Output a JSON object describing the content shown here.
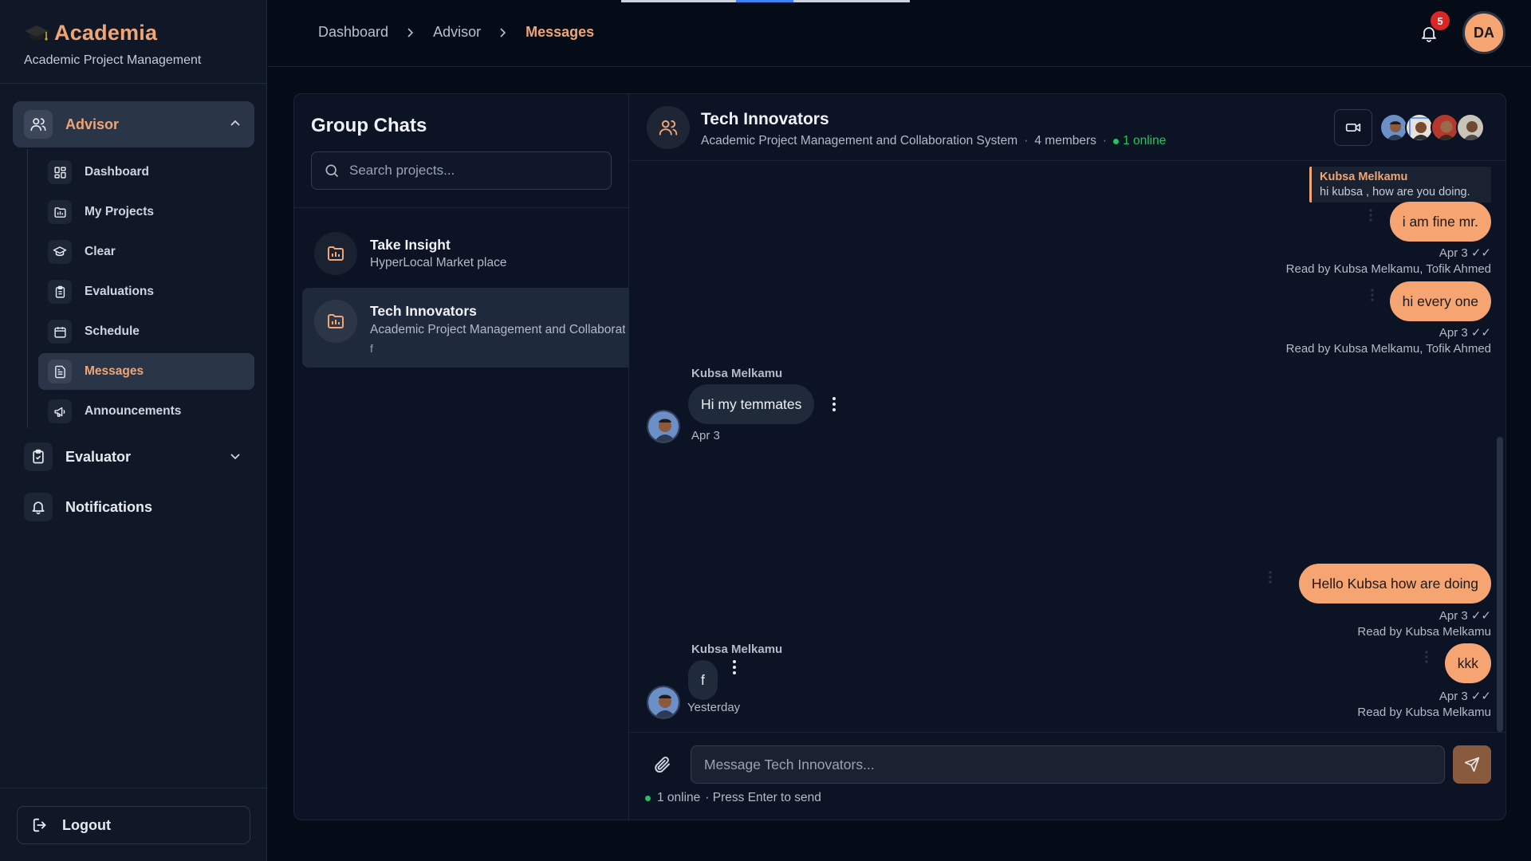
{
  "brand": {
    "title": "Academia",
    "subtitle": "Academic Project Management"
  },
  "sidebar": {
    "groups": [
      {
        "label": "Advisor",
        "icon": "users-icon",
        "expanded": true,
        "active": true
      },
      {
        "label": "Evaluator",
        "icon": "clipboard-check-icon",
        "expanded": false
      },
      {
        "label": "Notifications",
        "icon": "bell-icon"
      }
    ],
    "advisor_items": [
      {
        "label": "Dashboard",
        "icon": "grid-icon"
      },
      {
        "label": "My Projects",
        "icon": "folder-chart-icon"
      },
      {
        "label": "Clear",
        "icon": "graduation-cap-icon"
      },
      {
        "label": "Evaluations",
        "icon": "clipboard-list-icon"
      },
      {
        "label": "Schedule",
        "icon": "calendar-icon"
      },
      {
        "label": "Messages",
        "icon": "file-text-icon",
        "active": true
      },
      {
        "label": "Announcements",
        "icon": "megaphone-icon"
      }
    ],
    "logout_label": "Logout"
  },
  "header": {
    "breadcrumbs": [
      "Dashboard",
      "Advisor",
      "Messages"
    ],
    "notification_count": "5",
    "user_initials": "DA"
  },
  "chats": {
    "title": "Group Chats",
    "search_placeholder": "Search projects...",
    "items": [
      {
        "name": "Take Insight",
        "subtitle": "HyperLocal Market place",
        "last": ""
      },
      {
        "name": "Tech Innovators",
        "subtitle": "Academic Project Management and Collaboration System",
        "last": "f",
        "active": true
      }
    ]
  },
  "conversation": {
    "title": "Tech Innovators",
    "subtitle": "Academic Project Management and Collaboration System",
    "members": "4 members",
    "online": "1 online",
    "reply_quote": {
      "name": "Kubsa Melkamu",
      "text": "hi kubsa , how are you doing."
    },
    "messages": [
      {
        "dir": "out",
        "text": "i am fine mr.",
        "time": "Apr 3 ✓✓",
        "read": "Read by Kubsa Melkamu, Tofik Ahmed"
      },
      {
        "dir": "out",
        "text": "hi every one",
        "time": "Apr 3 ✓✓",
        "read": "Read by Kubsa Melkamu, Tofik Ahmed"
      },
      {
        "dir": "in",
        "sender": "Kubsa Melkamu",
        "text": "Hi my temmates",
        "time": "Apr 3"
      },
      {
        "dir": "out",
        "text": "Hello Kubsa how are doing",
        "time": "Apr 3 ✓✓",
        "read": "Read by Kubsa Melkamu"
      },
      {
        "dir": "out",
        "text": "kkk",
        "time": "Apr 3 ✓✓",
        "read": "Read by Kubsa Melkamu"
      },
      {
        "dir": "in",
        "sender": "Kubsa Melkamu",
        "text": "f",
        "time": "Yesterday"
      }
    ]
  },
  "composer": {
    "placeholder": "Message Tech Innovators...",
    "online": "1 online",
    "hint": "· Press Enter to send"
  },
  "colors": {
    "accent": "#f0a574",
    "bubble_out": "#f5a472",
    "online": "#22c55e",
    "badge": "#dc2626"
  }
}
